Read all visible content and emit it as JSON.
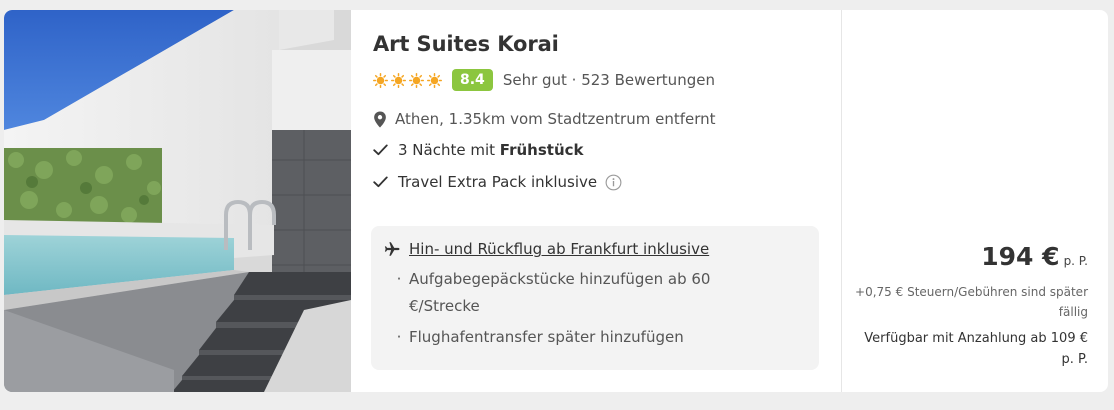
{
  "hotel": {
    "name": "Art Suites Korai",
    "stars": 4,
    "score": "8.4",
    "rating_text": "Sehr gut · 523 Bewertungen",
    "location": "Athen, 1.35km vom Stadtzentrum entfernt",
    "nights_prefix": "3 Nächte mit ",
    "nights_board": "Frühstück",
    "extra": "Travel Extra Pack inklusive"
  },
  "flight": {
    "title": "Hin- und Rückflug ab Frankfurt inklusive",
    "bullets": [
      "Aufgabegepäckstücke hinzufügen ab 60 €/Strecke",
      "Flughafentransfer später hinzufügen"
    ]
  },
  "price": {
    "amount": "194 €",
    "per_person": "p. P.",
    "fees": "+0,75 € Steuern/Gebühren sind später fällig",
    "deposit": "Verfügbar mit Anzahlung ab 109 € p. P."
  },
  "icons": {
    "sun": "sun-icon",
    "location": "location-pin-icon",
    "check": "check-icon",
    "info": "info-icon",
    "plane": "plane-icon"
  },
  "colors": {
    "score_bg": "#8cc63f",
    "sun": "#f5a623",
    "flight_box_bg": "#f3f3f3"
  }
}
